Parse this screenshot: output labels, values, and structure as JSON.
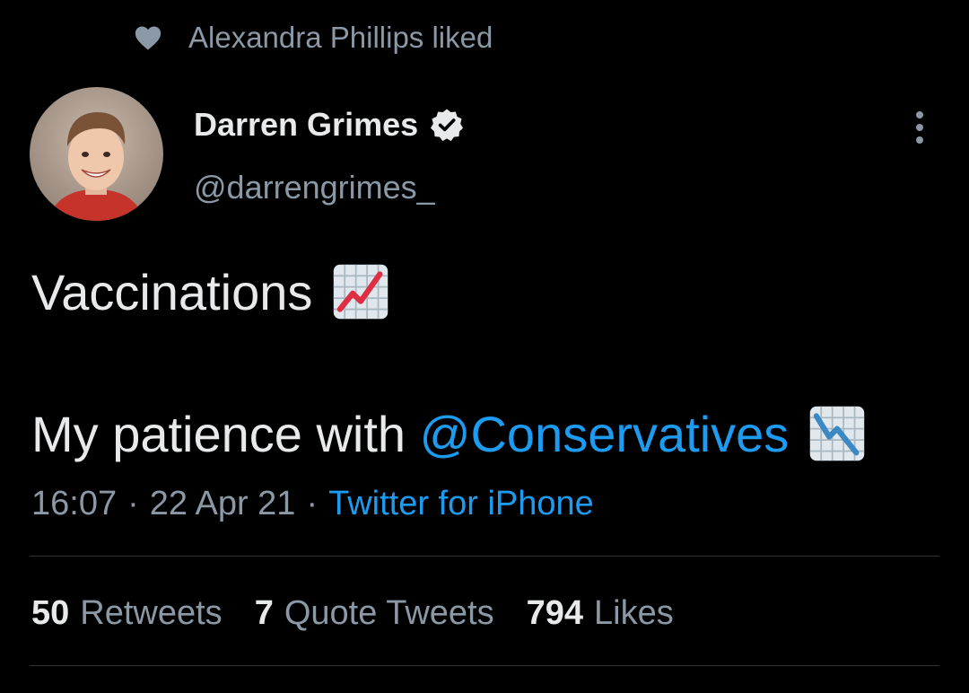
{
  "social_context": {
    "icon": "heart-icon",
    "text": "Alexandra Phillips liked"
  },
  "author": {
    "display_name": "Darren Grimes",
    "verified_icon": "verified-badge-icon",
    "handle": "@darrengrimes_",
    "avatar_icon": "avatar"
  },
  "more_icon": "more-options-icon",
  "tweet": {
    "line1_text": "Vaccinations",
    "line1_emoji": "chart-increasing-emoji",
    "line2_text": "My patience with ",
    "line2_mention": "@Conservatives",
    "line2_emoji": "chart-decreasing-emoji"
  },
  "meta": {
    "time": "16:07",
    "separator": "·",
    "date": "22 Apr 21",
    "source": "Twitter for iPhone"
  },
  "stats": {
    "retweets_count": "50",
    "retweets_label": "Retweets",
    "quotes_count": "7",
    "quotes_label": "Quote Tweets",
    "likes_count": "794",
    "likes_label": "Likes"
  },
  "colors": {
    "background": "#000000",
    "primary_text": "#e7e9ea",
    "secondary_text": "#8b98a5",
    "accent": "#1d9bf0",
    "divider": "#2f3336"
  }
}
